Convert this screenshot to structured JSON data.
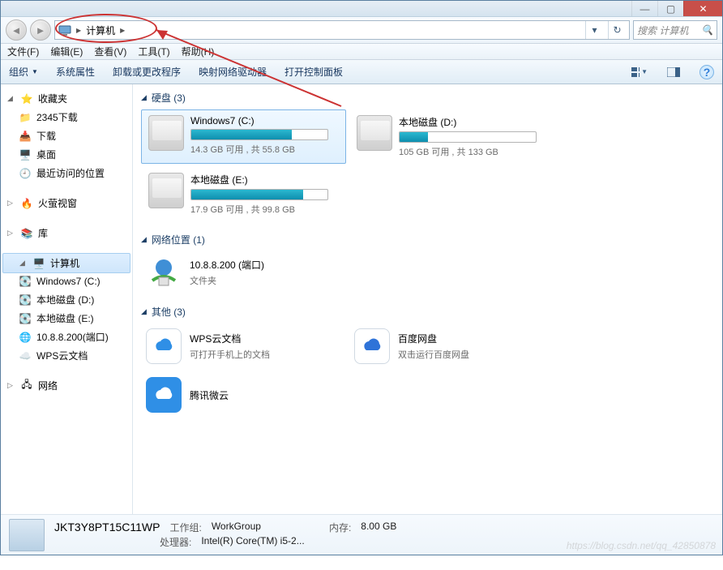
{
  "titlebar": {
    "min": "—",
    "max": "▢",
    "close": "✕"
  },
  "nav": {
    "crumb_root": "计算机",
    "history_dropdown": "▾",
    "refresh": "↻",
    "search_placeholder": "搜索 计算机"
  },
  "menu": {
    "file": "文件(F)",
    "edit": "编辑(E)",
    "view": "查看(V)",
    "tools": "工具(T)",
    "help": "帮助(H)"
  },
  "toolbar": {
    "organize": "组织",
    "sysprops": "系统属性",
    "uninstall": "卸载或更改程序",
    "mapdrive": "映射网络驱动器",
    "controlpanel": "打开控制面板"
  },
  "sidebar": {
    "favorites": {
      "label": "收藏夹",
      "items": [
        "2345下载",
        "下载",
        "桌面",
        "最近访问的位置"
      ]
    },
    "firefly": {
      "label": "火萤视窗"
    },
    "libraries": {
      "label": "库"
    },
    "computer": {
      "label": "计算机",
      "items": [
        "Windows7 (C:)",
        "本地磁盘 (D:)",
        "本地磁盘 (E:)",
        "10.8.8.200(端口)",
        "WPS云文档"
      ]
    },
    "network": {
      "label": "网络"
    }
  },
  "sections": {
    "drives": {
      "header": "硬盘 (3)"
    },
    "netloc": {
      "header": "网络位置 (1)"
    },
    "other": {
      "header": "其他 (3)"
    }
  },
  "drives": [
    {
      "name": "Windows7 (C:)",
      "free": "14.3 GB 可用 , 共 55.8 GB",
      "pct": 74,
      "selected": true
    },
    {
      "name": "本地磁盘 (D:)",
      "free": "105 GB 可用 , 共 133 GB",
      "pct": 21,
      "selected": false
    },
    {
      "name": "本地磁盘 (E:)",
      "free": "17.9 GB 可用 , 共 99.8 GB",
      "pct": 82,
      "selected": false
    }
  ],
  "netloc": {
    "name": "10.8.8.200 (端口)",
    "sub": "文件夹"
  },
  "others": [
    {
      "name": "WPS云文档",
      "sub": "可打开手机上的文档",
      "color": "#2f8fe6",
      "bg": "#fff",
      "border": "1px solid #d0d9e2"
    },
    {
      "name": "百度网盘",
      "sub": "双击运行百度网盘",
      "color": "#2f73d8",
      "bg": "#fff",
      "border": "1px solid #d0d9e2"
    },
    {
      "name": "腾讯微云",
      "sub": "",
      "color": "#fff",
      "bg": "#2f8fe6",
      "border": "none"
    }
  ],
  "details": {
    "name": "JKT3Y8PT15C11WP",
    "workgroup_label": "工作组:",
    "workgroup": "WorkGroup",
    "mem_label": "内存:",
    "mem": "8.00 GB",
    "cpu_label": "处理器:",
    "cpu": "Intel(R) Core(TM) i5-2..."
  },
  "watermark": "https://blog.csdn.net/qq_42850878"
}
